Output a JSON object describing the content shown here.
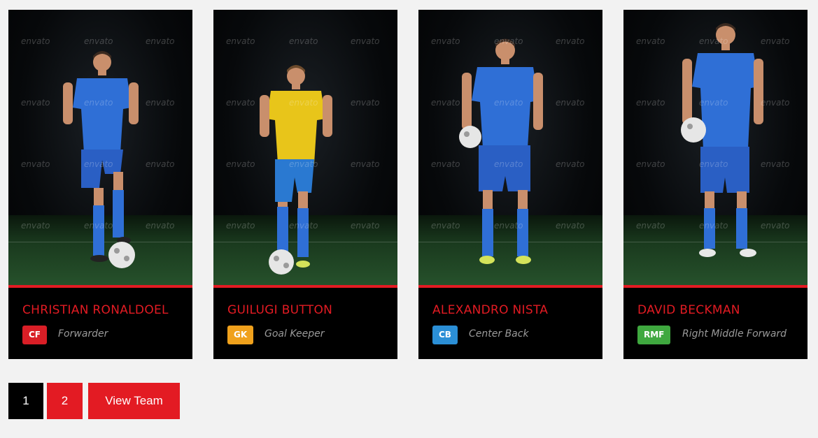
{
  "watermark": "envato",
  "colors": {
    "accent": "#e31b23",
    "cf": "#d91e26",
    "gk": "#f0a11c",
    "cb": "#2b8fd6",
    "rmf": "#3fa83f"
  },
  "players": [
    {
      "name": "CHRISTIAN RONALDOEL",
      "badge": "CF",
      "badge_color": "#d91e26",
      "role": "Forwarder",
      "kit": "#2f6fd6",
      "shirt": "#2f6fd6",
      "shorts": "#2a5fc4"
    },
    {
      "name": "GUILUGI BUTTON",
      "badge": "GK",
      "badge_color": "#f0a11c",
      "role": "Goal Keeper",
      "kit": "#e8c51a",
      "shirt": "#e8c51a",
      "shorts": "#2a79d1"
    },
    {
      "name": "ALEXANDRO NISTA",
      "badge": "CB",
      "badge_color": "#2b8fd6",
      "role": "Center Back",
      "kit": "#2f6fd6",
      "shirt": "#2f6fd6",
      "shorts": "#2a5fc4"
    },
    {
      "name": "DAVID BECKMAN",
      "badge": "RMF",
      "badge_color": "#3fa83f",
      "role": "Right Middle Forward",
      "kit": "#2f6fd6",
      "shirt": "#2f6fd6",
      "shorts": "#2a5fc4"
    }
  ],
  "pagination": {
    "pages": [
      "1",
      "2"
    ],
    "current": "1",
    "view_team_label": "View Team"
  }
}
